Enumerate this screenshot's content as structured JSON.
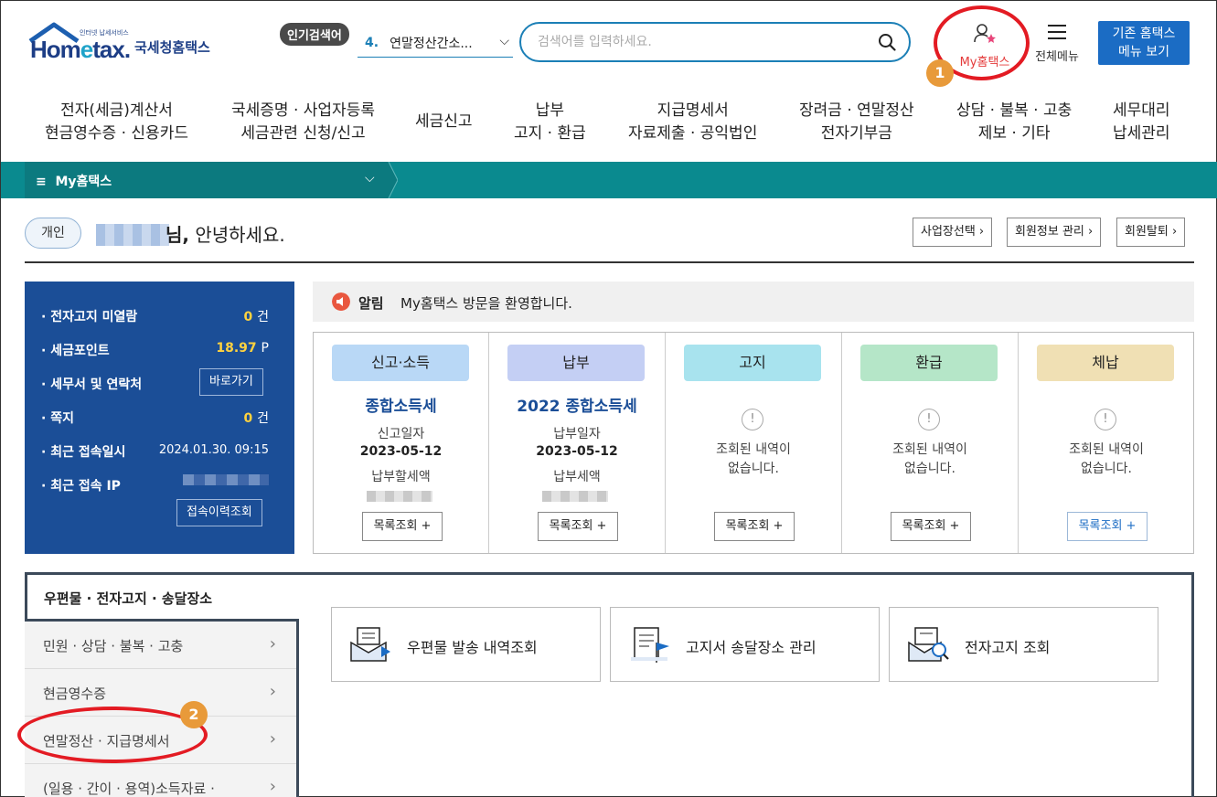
{
  "header": {
    "logo_tagline": "인터넷 납세서비스",
    "logo_word_pre": "Hom",
    "logo_word_e": "e",
    "logo_word_post": "tax.",
    "logo_kr": "국세청홈택스",
    "popular_badge": "인기검색어",
    "popular_rank": "4.",
    "popular_term": "연말정산간소...",
    "search_placeholder": "검색어를 입력하세요.",
    "my_hometax": "My홈택스",
    "all_menu": "전체메뉴",
    "legacy_line1": "기존 홈택스",
    "legacy_line2": "메뉴 보기"
  },
  "badges": {
    "step1": "1",
    "step2": "2"
  },
  "gnb": [
    {
      "l1": "전자(세금)계산서",
      "l2": "현금영수증 · 신용카드"
    },
    {
      "l1": "국세증명 · 사업자등록",
      "l2": "세금관련 신청/신고"
    },
    {
      "l1": "세금신고",
      "l2": ""
    },
    {
      "l1": "납부",
      "l2": "고지 · 환급"
    },
    {
      "l1": "지급명세서",
      "l2": "자료제출 · 공익법인"
    },
    {
      "l1": "장려금 · 연말정산",
      "l2": "전자기부금"
    },
    {
      "l1": "상담 · 불복 · 고충",
      "l2": "제보 · 기타"
    },
    {
      "l1": "세무대리",
      "l2": "납세관리"
    }
  ],
  "breadcrumb": {
    "label": "My홈택스",
    "menu_glyph": "≡"
  },
  "greeting": {
    "type_pill": "개인",
    "name_suffix": "님,",
    "message": " 안녕하세요.",
    "buttons": [
      "사업장선택 ›",
      "회원정보 관리 ›",
      "회원탈퇴 ›"
    ]
  },
  "info": {
    "rows": [
      {
        "label": "· 전자고지 미열람",
        "value": "0",
        "unit": "건"
      },
      {
        "label": "· 세금포인트",
        "value": "18.97",
        "unit": "P"
      },
      {
        "label": "· 세무서 및 연락처",
        "button": "바로가기"
      },
      {
        "label": "· 쪽지",
        "value": "0",
        "unit": "건"
      },
      {
        "label": "· 최근 접속일시",
        "text": "2024.01.30.  09:15"
      },
      {
        "label": "· 최근 접속 IP",
        "button": "접속이력조회"
      }
    ]
  },
  "notice": {
    "label": "알림",
    "text": "My홈택스 방문을 환영합니다."
  },
  "status_cards": [
    {
      "head": "신고·소득",
      "title": "종합소득세",
      "sub1": "신고일자",
      "date": "2023-05-12",
      "sub2": "납부할세액",
      "button": "목록조회 +",
      "color": "#b9d8f6"
    },
    {
      "head": "납부",
      "title": "2022 종합소득세",
      "sub1": "납부일자",
      "date": "2023-05-12",
      "sub2": "납부세액",
      "button": "목록조회 +",
      "color": "#c4cff4"
    },
    {
      "head": "고지",
      "none_line1": "조회된 내역이",
      "none_line2": "없습니다.",
      "button": "목록조회 +",
      "color": "#a8e3ee"
    },
    {
      "head": "환급",
      "none_line1": "조회된 내역이",
      "none_line2": "없습니다.",
      "button": "목록조회 +",
      "color": "#b5e6c8"
    },
    {
      "head": "체납",
      "none_line1": "조회된 내역이",
      "none_line2": "없습니다.",
      "button": "목록조회 +",
      "color": "#f0e0b4"
    }
  ],
  "bottom": {
    "active_tab": "우편물 · 전자고지 · 송달장소",
    "side_items": [
      "민원 · 상담 · 불복 · 고충",
      "현금영수증",
      "연말정산 · 지급명세서",
      "(일용 · 간이 · 용역)소득자료 ·"
    ],
    "menu_cards": [
      "우편물 발송 내역조회",
      "고지서 송달장소 관리",
      "전자고지 조회"
    ]
  },
  "colors": {
    "brand": "#1d3e86",
    "teal": "#0a8a8f",
    "panel": "#1b4e97",
    "highlight": "#e31b23",
    "badge": "#e89a3a"
  }
}
